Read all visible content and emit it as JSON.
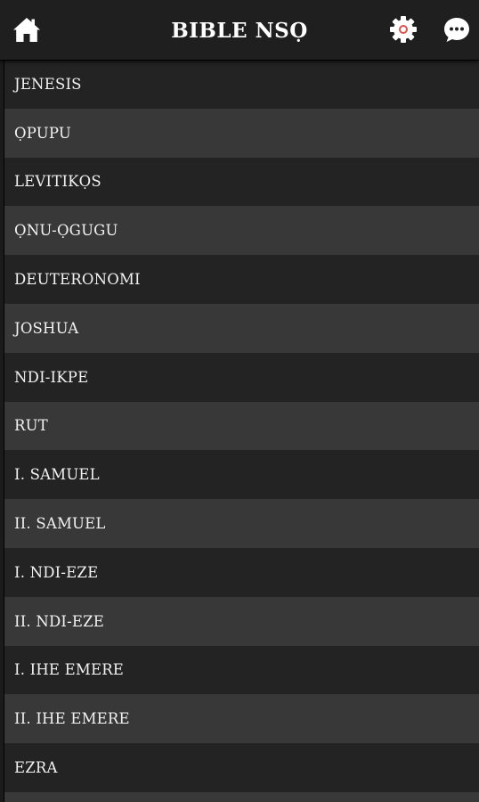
{
  "header": {
    "title": "BIBLE NSỌ",
    "home_icon": "home-icon",
    "settings_icon": "gear-icon",
    "chat_icon": "chat-bubble-icon"
  },
  "books": [
    {
      "label": "JENESIS"
    },
    {
      "label": "ỌPUPU"
    },
    {
      "label": "LEVITIKỌS"
    },
    {
      "label": "ỌNU-ỌGUGU"
    },
    {
      "label": "DEUTERONOMI"
    },
    {
      "label": "JOSHUA"
    },
    {
      "label": "NDI-IKPE"
    },
    {
      "label": "RUT"
    },
    {
      "label": "I. SAMUEL"
    },
    {
      "label": "II. SAMUEL"
    },
    {
      "label": "I. NDI-EZE"
    },
    {
      "label": "II. NDI-EZE"
    },
    {
      "label": "I. IHE EMERE"
    },
    {
      "label": "II. IHE EMERE"
    },
    {
      "label": "EZRA"
    },
    {
      "label": ""
    }
  ],
  "colors": {
    "appbar": "#1f1f1f",
    "row_dark": "#232323",
    "row_light": "#383838",
    "text": "#f2f2f2",
    "gear_center": "#d9534f"
  }
}
